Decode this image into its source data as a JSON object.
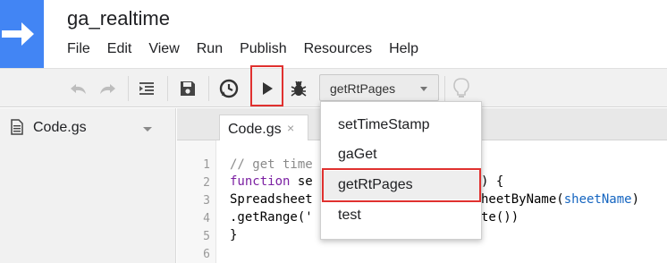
{
  "app": {
    "title": "ga_realtime",
    "logo_icon": "apps-script-arrow-icon",
    "brand_color": "#4285f4"
  },
  "menu": [
    "File",
    "Edit",
    "View",
    "Run",
    "Publish",
    "Resources",
    "Help"
  ],
  "toolbar": {
    "icons": [
      "undo-icon",
      "redo-icon",
      "indent-icon",
      "save-icon",
      "triggers-clock-icon",
      "run-play-icon",
      "debug-bug-icon",
      "lightbulb-icon"
    ],
    "function_select": {
      "selected": "getRtPages"
    },
    "highlight_color": "#e0312f"
  },
  "sidebar": {
    "files": [
      {
        "name": "Code.gs",
        "icon": "document-icon"
      }
    ]
  },
  "editor": {
    "tab": {
      "label": "Code.gs",
      "close": "×"
    },
    "line_numbers": [
      "1",
      "2",
      "3",
      "4",
      "5",
      "6"
    ],
    "code": {
      "l1": "// get time",
      "l2_kw": "function",
      "l2_a": " se",
      "l2_b": ") {",
      "l3_a": "Spreadsheet",
      "l3_b": "heetByName(",
      "l3_var": "sheetName",
      "l3_c": ")",
      "l4_a": ".getRange('",
      "l4_str": "",
      "l4_b": "te())",
      "l5": "}"
    }
  },
  "dropdown": {
    "items": [
      "setTimeStamp",
      "gaGet",
      "getRtPages",
      "test"
    ],
    "highlighted": "getRtPages"
  }
}
